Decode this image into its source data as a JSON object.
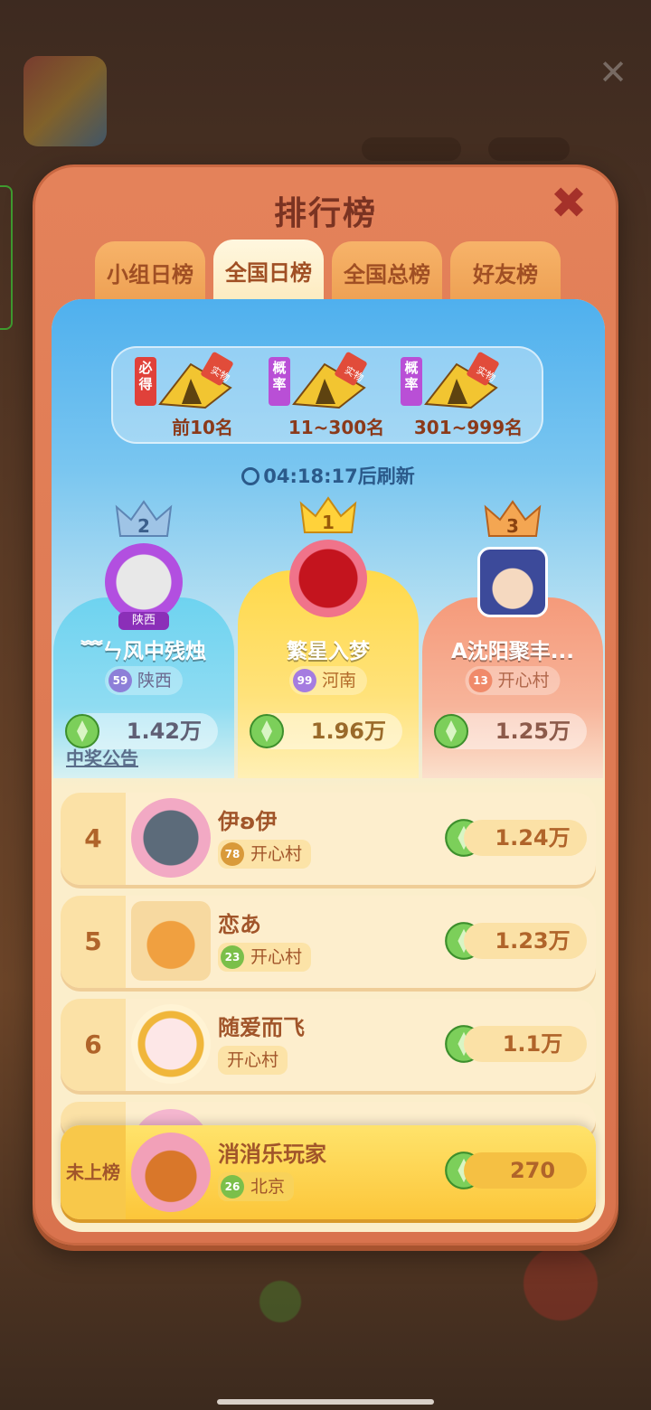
{
  "modal": {
    "title": "排行榜",
    "close_icon": "close-icon"
  },
  "tabs": [
    {
      "label": "小组日榜",
      "active": false
    },
    {
      "label": "全国日榜",
      "active": true
    },
    {
      "label": "全国总榜",
      "active": false
    },
    {
      "label": "好友榜",
      "active": false
    }
  ],
  "prizes": [
    {
      "tag": "必得",
      "range": "前10名",
      "badge": "实物",
      "icon": "tent-icon"
    },
    {
      "tag": "概率",
      "range": "11~300名",
      "badge": "实物",
      "icon": "tent-icon"
    },
    {
      "tag": "概率",
      "range": "301~999名",
      "badge": "实物",
      "icon": "tent-icon"
    }
  ],
  "refresh": {
    "time": "04:18:17",
    "suffix": "后刷新",
    "icon": "clock-icon"
  },
  "podium": [
    {
      "rank": "2",
      "name": "﹌ㄣ风中残烛",
      "avatar_tag": "陕西",
      "level": "59",
      "region": "陕西",
      "score": "1.42万"
    },
    {
      "rank": "1",
      "name": "繁星入梦",
      "level": "99",
      "region": "河南",
      "score": "1.96万"
    },
    {
      "rank": "3",
      "name": "A沈阳聚丰...",
      "level": "13",
      "region": "开心村",
      "score": "1.25万"
    }
  ],
  "notice_link": "中奖公告",
  "rows": [
    {
      "rank": "4",
      "name": "伊ʚ伊",
      "level": "78",
      "region": "开心村",
      "score": "1.24万"
    },
    {
      "rank": "5",
      "name": "恋あ",
      "level": "23",
      "region": "开心村",
      "score": "1.23万"
    },
    {
      "rank": "6",
      "name": "随爱而飞",
      "level": "",
      "region": "开心村",
      "score": "1.1万"
    }
  ],
  "me": {
    "rank": "未上榜",
    "name": "消消乐玩家",
    "level": "26",
    "region": "北京",
    "score": "270"
  },
  "colors": {
    "modal_bg": "#e4825a",
    "tab_active": "#fff7df",
    "title_text": "#7a3322",
    "gold_bar": "#fcc63a"
  }
}
